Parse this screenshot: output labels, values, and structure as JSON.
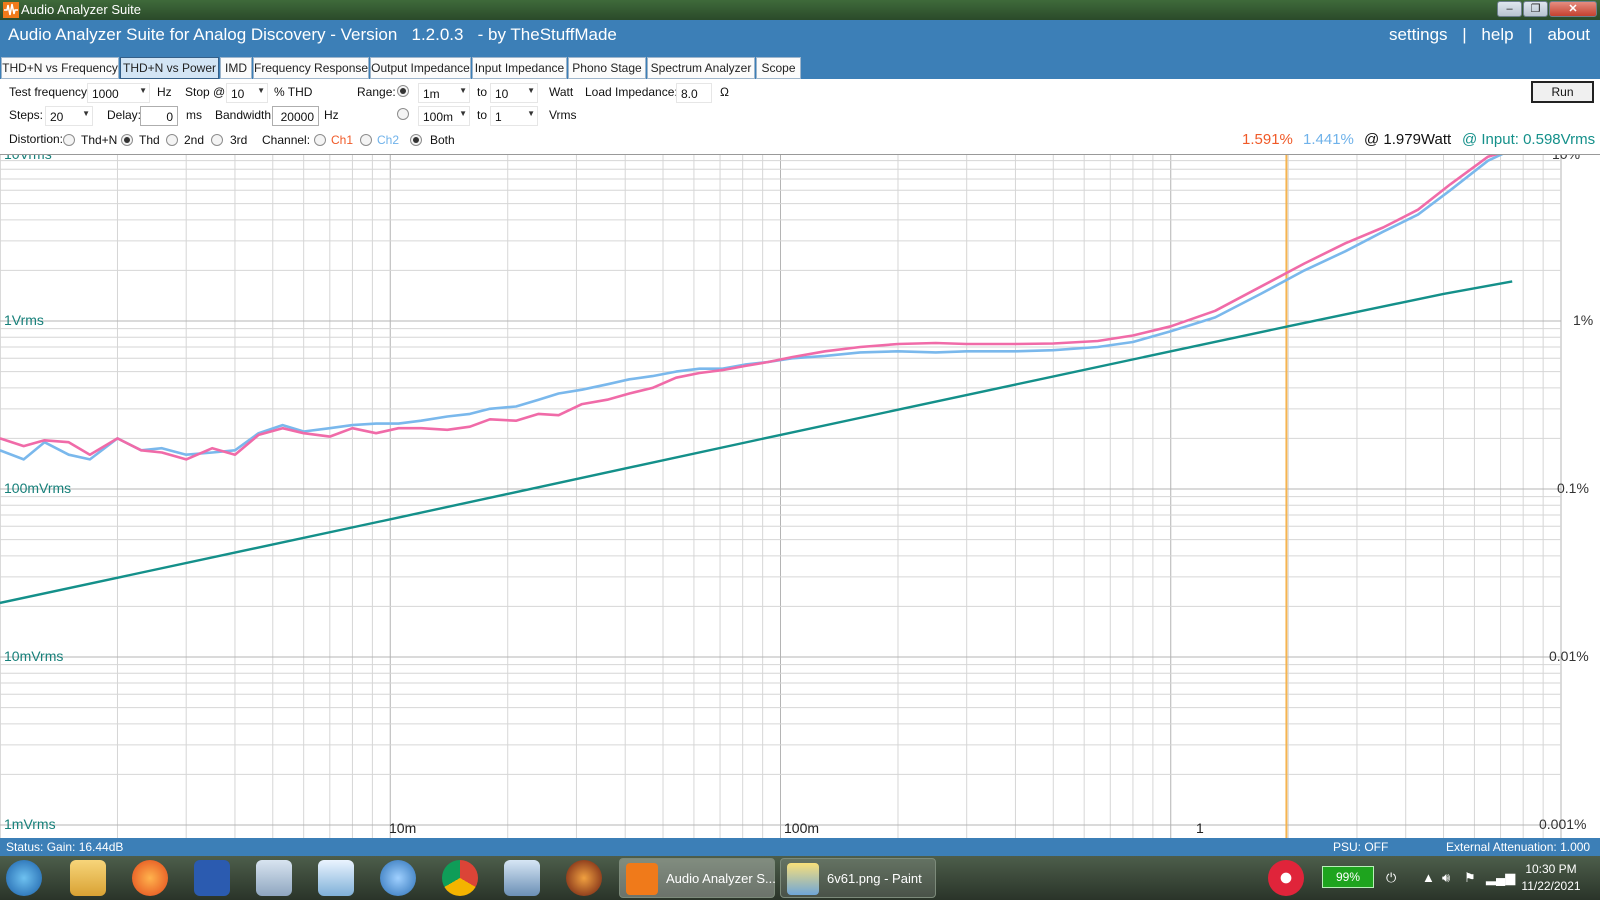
{
  "window": {
    "title": "Audio Analyzer Suite",
    "buttons": [
      "–",
      "❐",
      "✕"
    ]
  },
  "header": {
    "title": "Audio Analyzer Suite for Analog Discovery - Version   1.2.0.3   - by TheStuffMade",
    "links": [
      "settings",
      "help",
      "about"
    ],
    "separator": "|"
  },
  "tabs": [
    {
      "label": "THD+N vs Frequency"
    },
    {
      "label": "THD+N vs Power",
      "active": true
    },
    {
      "label": "IMD"
    },
    {
      "label": "Frequency Response"
    },
    {
      "label": "Output Impedance"
    },
    {
      "label": "Input Impedance"
    },
    {
      "label": "Phono Stage"
    },
    {
      "label": "Spectrum Analyzer"
    },
    {
      "label": "Scope"
    }
  ],
  "controls": {
    "test_frequency": {
      "label": "Test frequency:",
      "value": "1000",
      "unit": "Hz"
    },
    "stop": {
      "label": "Stop @",
      "value": "10",
      "unit": "% THD"
    },
    "range": {
      "label": "Range:",
      "watt": {
        "from": "1m",
        "to_label": "to",
        "to": "10",
        "unit": "Watt",
        "selected": true
      },
      "vrms": {
        "from": "100m",
        "to_label": "to",
        "to": "1",
        "unit": "Vrms",
        "selected": false
      }
    },
    "load_impedance": {
      "label": "Load Impedance:",
      "value": "8.0",
      "unit": "Ω"
    },
    "steps": {
      "label": "Steps:",
      "value": "20"
    },
    "delay": {
      "label": "Delay:",
      "value": "0",
      "unit": "ms"
    },
    "bandwidth": {
      "label": "Bandwidth:",
      "value": "20000",
      "unit": "Hz"
    },
    "distortion": {
      "label": "Distortion:",
      "options": [
        "Thd+N",
        "Thd",
        "2nd",
        "3rd"
      ],
      "selected": "Thd"
    },
    "channel": {
      "label": "Channel:",
      "options": [
        "Ch1",
        "Ch2",
        "Both"
      ],
      "selected": "Both"
    },
    "run_label": "Run"
  },
  "readout": {
    "ch1": "1.591%",
    "ch2": "1.441%",
    "power": "@ 1.979Watt",
    "input": "@ Input: 0.598Vrms"
  },
  "colors": {
    "ch1": "#f06ba8",
    "ch1_text": "#f05a28",
    "ch2": "#7ab8ec",
    "input": "#14908a",
    "cursor": "#f5b450",
    "header": "#3c7fb7"
  },
  "plot": {
    "left_labels": [
      "10Vrms",
      "1Vrms",
      "100mVrms",
      "10mVrms",
      "1mVrms"
    ],
    "right_labels": [
      "10%",
      "1%",
      "0.1%",
      "0.01%",
      "0.001%"
    ],
    "x_labels": [
      "10m",
      "100m",
      "1"
    ]
  },
  "chart_data": {
    "type": "line",
    "title": "",
    "xlabel": "",
    "ylabel": "",
    "x_scale": "log",
    "y_scale": "log",
    "xlim": [
      0.001,
      10
    ],
    "ylim_percent": [
      0.001,
      10
    ],
    "cursor_x": 1.979,
    "series": [
      {
        "name": "Ch1",
        "x": [
          0.001,
          0.00115,
          0.0013,
          0.0015,
          0.0017,
          0.002,
          0.0023,
          0.0026,
          0.003,
          0.0035,
          0.004,
          0.0046,
          0.0053,
          0.006,
          0.007,
          0.008,
          0.0092,
          0.0105,
          0.012,
          0.014,
          0.016,
          0.018,
          0.021,
          0.024,
          0.027,
          0.031,
          0.036,
          0.041,
          0.047,
          0.054,
          0.062,
          0.071,
          0.081,
          0.093,
          0.107,
          0.13,
          0.16,
          0.2,
          0.25,
          0.3,
          0.4,
          0.5,
          0.65,
          0.8,
          1.0,
          1.3,
          1.7,
          2.2,
          2.8,
          3.5,
          4.3,
          5.2,
          6.5,
          7.5
        ],
        "y": [
          0.2,
          0.18,
          0.195,
          0.19,
          0.16,
          0.2,
          0.17,
          0.165,
          0.15,
          0.175,
          0.16,
          0.21,
          0.23,
          0.215,
          0.205,
          0.23,
          0.215,
          0.23,
          0.23,
          0.225,
          0.235,
          0.26,
          0.255,
          0.28,
          0.275,
          0.32,
          0.34,
          0.37,
          0.4,
          0.46,
          0.49,
          0.51,
          0.54,
          0.57,
          0.61,
          0.66,
          0.7,
          0.73,
          0.74,
          0.73,
          0.73,
          0.735,
          0.76,
          0.82,
          0.93,
          1.15,
          1.6,
          2.2,
          2.9,
          3.6,
          4.6,
          6.5,
          9.5,
          10.5
        ]
      },
      {
        "name": "Ch2",
        "x": [
          0.001,
          0.00115,
          0.0013,
          0.0015,
          0.0017,
          0.002,
          0.0023,
          0.0026,
          0.003,
          0.0035,
          0.004,
          0.0046,
          0.0053,
          0.006,
          0.007,
          0.008,
          0.0092,
          0.0105,
          0.012,
          0.014,
          0.016,
          0.018,
          0.021,
          0.024,
          0.027,
          0.031,
          0.036,
          0.041,
          0.047,
          0.054,
          0.062,
          0.071,
          0.081,
          0.093,
          0.107,
          0.13,
          0.16,
          0.2,
          0.25,
          0.3,
          0.4,
          0.5,
          0.65,
          0.8,
          1.0,
          1.3,
          1.7,
          2.2,
          2.8,
          3.5,
          4.3,
          5.2,
          6.5,
          7.5
        ],
        "y": [
          0.17,
          0.15,
          0.19,
          0.16,
          0.15,
          0.2,
          0.17,
          0.175,
          0.16,
          0.165,
          0.17,
          0.215,
          0.24,
          0.22,
          0.23,
          0.24,
          0.245,
          0.245,
          0.255,
          0.27,
          0.28,
          0.3,
          0.31,
          0.34,
          0.37,
          0.39,
          0.42,
          0.45,
          0.47,
          0.5,
          0.52,
          0.52,
          0.55,
          0.57,
          0.6,
          0.62,
          0.65,
          0.66,
          0.65,
          0.66,
          0.66,
          0.67,
          0.7,
          0.75,
          0.87,
          1.05,
          1.45,
          2.0,
          2.6,
          3.4,
          4.3,
          6.0,
          9.0,
          10.5
        ]
      },
      {
        "name": "Input",
        "x": [
          0.001,
          0.01,
          0.1,
          1,
          2,
          5,
          7.5
        ],
        "y": [
          0.021,
          0.066,
          0.21,
          0.66,
          0.93,
          1.45,
          1.72
        ]
      }
    ]
  }
}
